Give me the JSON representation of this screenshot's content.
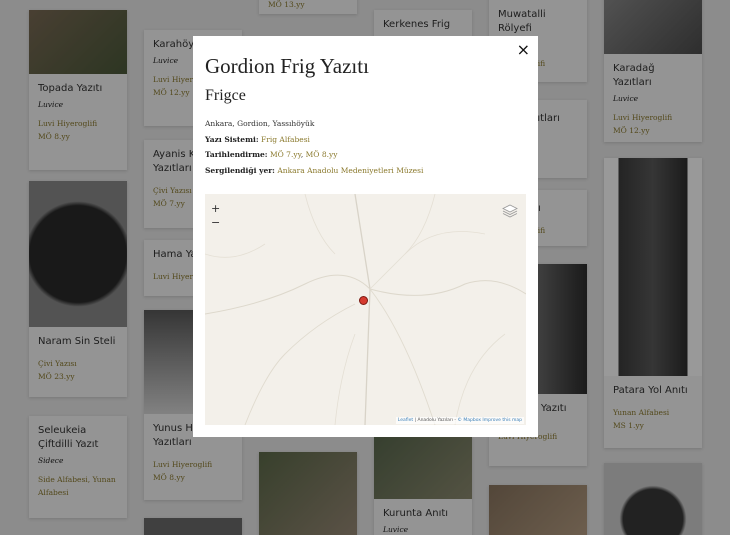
{
  "cards": [
    {
      "title": "Topada Yazıtı",
      "sub": "Luvice",
      "meta": "Luvi Hiyeroglifi",
      "date": "MÖ 8.yy"
    },
    {
      "title": "Naram Sin Steli",
      "sub": "",
      "meta": "Çivi Yazısı",
      "date": "MÖ 23.yy"
    },
    {
      "title": "Seleukeia Çiftdilli Yazıt",
      "sub": "Sidece",
      "meta": "Side Alfabesi, Yunan Alfabesi",
      "date": ""
    },
    {
      "title": "Karahöyük",
      "sub": "Luvice",
      "meta": "Luvi Hiyer",
      "date": "MÖ 12.yy"
    },
    {
      "title": "Ayanis Ka Yazıtları",
      "sub": "",
      "meta": "Çivi Yazısı",
      "date": "MÖ 7.yy"
    },
    {
      "title": "Hama Ya",
      "sub": "",
      "meta": "Luvi Hiyer",
      "date": ""
    },
    {
      "title": "Yunus Hö Yazıtları",
      "sub": "",
      "meta": "Luvi Hiyeroglifi",
      "date": "MÖ 8.yy"
    },
    {
      "title": "MÖ 13.yy",
      "sub": "",
      "meta": "",
      "date": ""
    },
    {
      "title": "Kerkenes Frig",
      "sub": "",
      "meta": "",
      "date": ""
    },
    {
      "title": "Kurunta Anıtı",
      "sub": "Luvice",
      "meta": "",
      "date": ""
    },
    {
      "title": "Muwatalli Rölyefi",
      "sub": "Luvice",
      "meta": "oglifi",
      "date": ""
    },
    {
      "title": "azıtları",
      "sub": "",
      "meta": "esi",
      "date": ""
    },
    {
      "title": "zıtı",
      "sub": "",
      "meta": "oglifi",
      "date": ""
    },
    {
      "title": "eli Yazıtı",
      "sub": "",
      "meta": "Luvi Hiyeroglifi",
      "date": ""
    },
    {
      "title": "Karadağ Yazıtları",
      "sub": "Luvice",
      "meta": "Luvi Hiyeroglifi",
      "date": "MÖ 12.yy"
    },
    {
      "title": "Patara Yol Anıtı",
      "sub": "",
      "meta": "Yunan Alfabesi",
      "date": "MS 1.yy"
    },
    {
      "title": "MÖ 8.yy",
      "sub": "",
      "meta": "",
      "date": ""
    }
  ],
  "modal": {
    "close": "×",
    "title": "Gordion Frig Yazıtı",
    "subtitle": "Frigce",
    "location": "Ankara, Gordion, Yassıhöyük",
    "script_label": "Yazı Sistemi:",
    "script_value": "Frig Alfabesi",
    "date_label": "Tarihlendirme:",
    "date_value_1": "MÖ 7.yy",
    "date_sep": ",",
    "date_value_2": "MÖ 8.yy",
    "exhibit_label": "Sergilendiği yer:",
    "exhibit_value": "Ankara Anadolu Medeniyetleri Müzesi"
  },
  "map": {
    "zoom_in": "+",
    "zoom_out": "−",
    "attrib_leaflet": "Leaflet",
    "attrib_sep": " | Anadolu Yazıları - ",
    "attrib_mapbox": "© Mapbox Improve this map"
  },
  "colors": {
    "link": "#8b7a2e",
    "marker": "#d53a2f",
    "overlay": "rgba(0,0,0,0.40)"
  }
}
